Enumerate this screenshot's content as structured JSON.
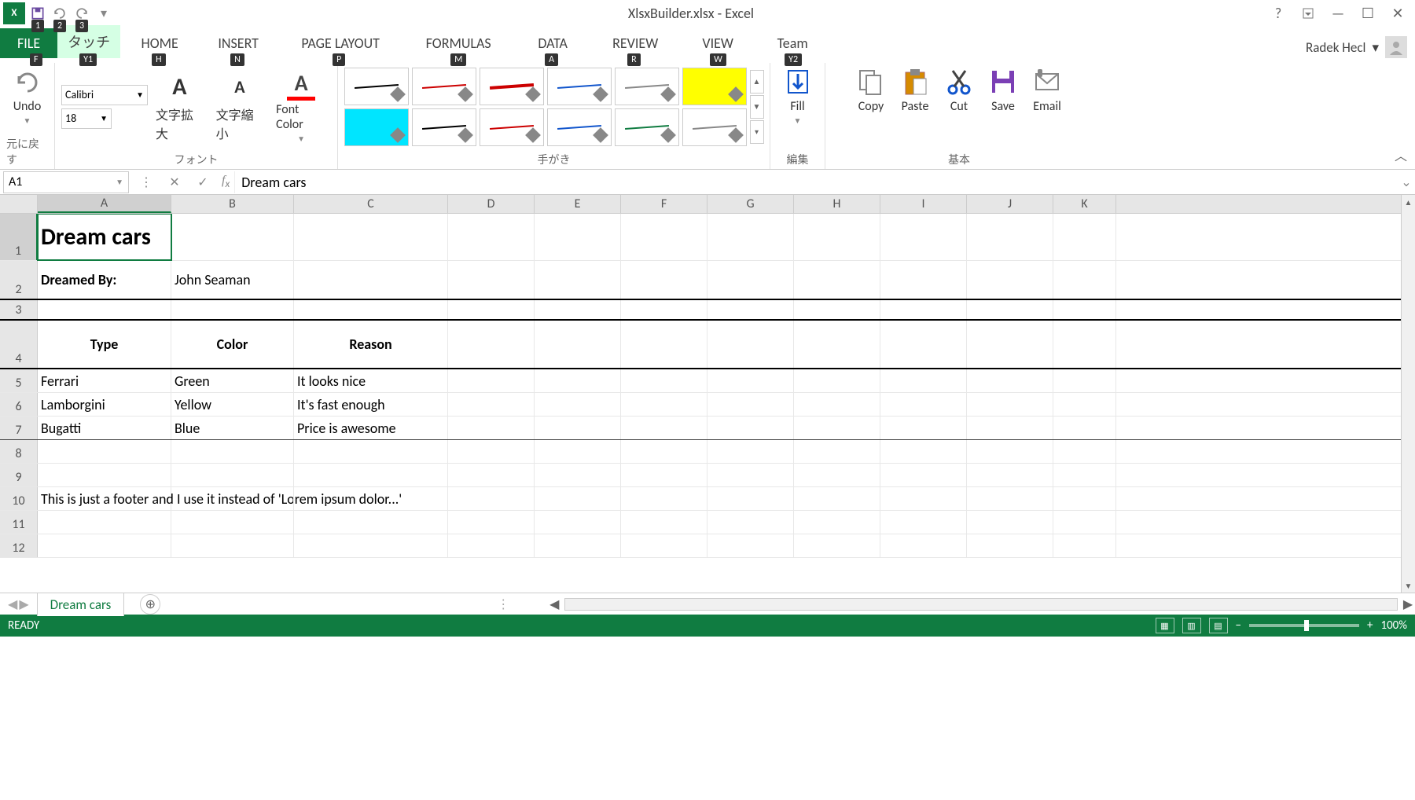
{
  "app": {
    "title": "XlsxBuilder.xlsx - Excel"
  },
  "qat_keytips": [
    "1",
    "2",
    "3"
  ],
  "tabs": {
    "file": "FILE",
    "touch": "タッチ",
    "list": [
      "HOME",
      "INSERT",
      "PAGE LAYOUT",
      "FORMULAS",
      "DATA",
      "REVIEW",
      "VIEW",
      "Team"
    ],
    "keytips": {
      "file": "F",
      "touch": "Y1",
      "home": "H",
      "insert": "N",
      "page_layout": "P",
      "formulas": "M",
      "data": "A",
      "review": "R",
      "view": "W",
      "team": "Y2"
    }
  },
  "user": {
    "name": "Radek Hecl"
  },
  "ribbon": {
    "undo": {
      "label": "Undo",
      "group": "元に戻す"
    },
    "font": {
      "name": "Calibri",
      "size": "18",
      "enlarge": "文字拡大",
      "shrink": "文字縮小",
      "color_label": "Font Color",
      "group": "フォント"
    },
    "pens": {
      "group": "手がき",
      "colors_row1": [
        "#000000",
        "#cc0000",
        "#cc0000",
        "#1155cc",
        "#888888",
        "#ffff00"
      ],
      "colors_row2": [
        "#00e5ff",
        "#000000",
        "#cc0000",
        "#1155cc",
        "#107c41",
        "#888888"
      ]
    },
    "edit": {
      "fill": "Fill",
      "group": "編集"
    },
    "basic": {
      "copy": "Copy",
      "paste": "Paste",
      "cut": "Cut",
      "save": "Save",
      "email": "Email",
      "group": "基本"
    }
  },
  "formula_bar": {
    "name_box": "A1",
    "value": "Dream cars"
  },
  "columns": [
    "A",
    "B",
    "C",
    "D",
    "E",
    "F",
    "G",
    "H",
    "I",
    "J",
    "K"
  ],
  "sheet": {
    "rows": [
      "1",
      "2",
      "3",
      "4",
      "5",
      "6",
      "7",
      "8",
      "9",
      "10",
      "11",
      "12"
    ],
    "a1": "Dream cars",
    "a2": "Dreamed By:",
    "b2": "John Seaman",
    "a4": "Type",
    "b4": "Color",
    "c4": "Reason",
    "a5": "Ferrari",
    "b5": "Green",
    "c5": "It looks nice",
    "a6": "Lamborgini",
    "b6": "Yellow",
    "c6": "It's fast enough",
    "a7": "Bugatti",
    "b7": "Blue",
    "c7": "Price is awesome",
    "a10": "This is just a footer and I use it instead of 'Lorem ipsum dolor...'"
  },
  "sheet_tabs": {
    "active": "Dream cars"
  },
  "status": {
    "ready": "READY",
    "zoom": "100%"
  }
}
